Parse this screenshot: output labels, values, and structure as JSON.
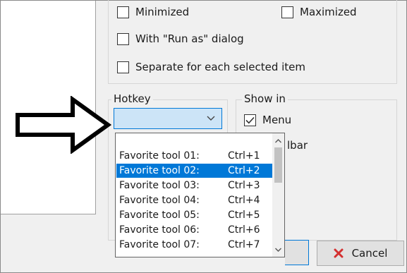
{
  "options": {
    "minimized_label": "Minimized",
    "maximized_label": "Maximized",
    "run_as_label": "With \"Run as\" dialog",
    "separate_label": "Separate for each selected item"
  },
  "hotkey": {
    "group_label": "Hotkey",
    "selected_value": "",
    "items": [
      {
        "name": "Favorite tool 01:",
        "key": "Ctrl+1"
      },
      {
        "name": "Favorite tool 02:",
        "key": "Ctrl+2"
      },
      {
        "name": "Favorite tool 03:",
        "key": "Ctrl+3"
      },
      {
        "name": "Favorite tool 04:",
        "key": "Ctrl+4"
      },
      {
        "name": "Favorite tool 05:",
        "key": "Ctrl+5"
      },
      {
        "name": "Favorite tool 06:",
        "key": "Ctrl+6"
      },
      {
        "name": "Favorite tool 07:",
        "key": "Ctrl+7"
      }
    ],
    "highlighted_index": 1
  },
  "show_in": {
    "group_label": "Show in",
    "menu_label": "Menu",
    "menu_checked": true,
    "toolbar_label_fragment": "lbar"
  },
  "buttons": {
    "cancel_label": "Cancel"
  },
  "annotation": {
    "arrow_icon": "outline-arrow-right-icon"
  },
  "colors": {
    "selection": "#0078d7",
    "combo_bg": "#cce4f7",
    "cancel_x": "#d32f2f"
  }
}
